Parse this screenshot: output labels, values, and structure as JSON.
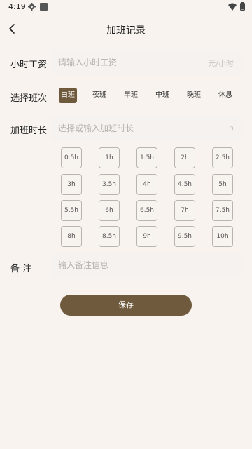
{
  "status_bar": {
    "time": "4:19"
  },
  "header": {
    "title": "加班记录"
  },
  "hourly_wage": {
    "label": "小时工资",
    "placeholder": "请输入小时工资",
    "unit": "元/小时"
  },
  "shift": {
    "label": "选择班次",
    "options": [
      "白班",
      "夜班",
      "早班",
      "中班",
      "晚班",
      "休息"
    ],
    "selected": "白班"
  },
  "duration": {
    "label": "加班时长",
    "placeholder": "选择或输入加班时长",
    "unit": "h",
    "options": [
      "0.5h",
      "1h",
      "1.5h",
      "2h",
      "2.5h",
      "3h",
      "3.5h",
      "4h",
      "4.5h",
      "5h",
      "5.5h",
      "6h",
      "6.5h",
      "7h",
      "7.5h",
      "8h",
      "8.5h",
      "9h",
      "9.5h",
      "10h"
    ]
  },
  "note": {
    "label": "备 注",
    "placeholder": "输入备注信息"
  },
  "save_label": "保存",
  "colors": {
    "background": "#f8f3ee",
    "accent": "#705a3e"
  }
}
